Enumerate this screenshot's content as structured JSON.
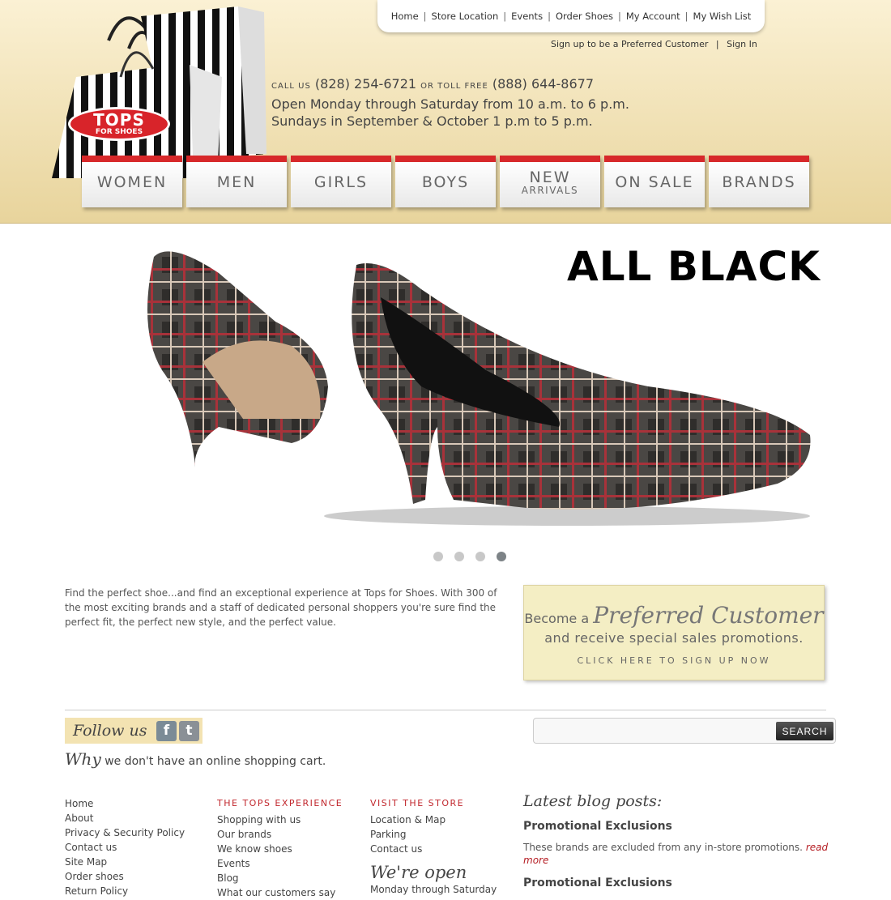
{
  "top_nav": [
    "Home",
    "Store Location",
    "Events",
    "Order Shoes",
    "My Account",
    "My Wish List"
  ],
  "account_links": {
    "preferred": "Sign up to be a Preferred Customer",
    "sign_in": "Sign In"
  },
  "logo": {
    "big": "TOPS",
    "small": "FOR SHOES"
  },
  "contact": {
    "call_label": "CALL US",
    "local": "(828) 254-6721",
    "toll_label": "OR TOLL FREE",
    "toll": "(888) 644-8677",
    "hours1": "Open Monday through Saturday from 10 a.m. to 6 p.m.",
    "hours2": "Sundays in September & October 1 p.m to 5 p.m."
  },
  "categories": [
    {
      "label": "WOMEN",
      "sub": ""
    },
    {
      "label": "MEN",
      "sub": ""
    },
    {
      "label": "GIRLS",
      "sub": ""
    },
    {
      "label": "BOYS",
      "sub": ""
    },
    {
      "label": "NEW",
      "sub": "ARRIVALS"
    },
    {
      "label": "ON SALE",
      "sub": ""
    },
    {
      "label": "BRANDS",
      "sub": ""
    }
  ],
  "hero": {
    "title": "ALL BLACK",
    "active_slide": 4,
    "slide_count": 4
  },
  "intro": "Find the perfect shoe...and find an exceptional experience at Tops for Shoes. With 300 of the most exciting brands and a staff of dedicated personal shoppers you're sure find the perfect fit, the perfect new style, and the perfect value.",
  "promo": {
    "become": "Become a",
    "script": "Preferred Customer",
    "line2": "and receive special sales promotions.",
    "cta": "CLICK HERE TO SIGN UP NOW"
  },
  "social": {
    "follow": "Follow us",
    "why_script": "Why",
    "why_rest": "we don't have an online shopping cart."
  },
  "search": {
    "button": "SEARCH",
    "placeholder": ""
  },
  "footer": {
    "col1": [
      "Home",
      "About",
      "Privacy & Security Policy",
      "Contact us",
      "Site Map",
      "Order shoes",
      "Return Policy"
    ],
    "col2": {
      "head": "THE TOPS EXPERIENCE",
      "links": [
        "Shopping with us",
        "Our brands",
        "We know shoes",
        "Events",
        "Blog",
        "What our customers say"
      ]
    },
    "col3": {
      "head": "VISIT THE STORE",
      "links": [
        "Location & Map",
        "Parking",
        "Contact us"
      ],
      "open_script": "We're open",
      "open_text": "Monday through Saturday"
    }
  },
  "blog": {
    "heading": "Latest blog posts:",
    "post1_title": "Promotional Exclusions",
    "post1_body": "These brands are excluded from any in-store promotions.",
    "read_more": "read more",
    "post2_title": "Promotional Exclusions"
  },
  "colors": {
    "accent_red": "#d7282a",
    "header_gold": "#e8d49c"
  }
}
